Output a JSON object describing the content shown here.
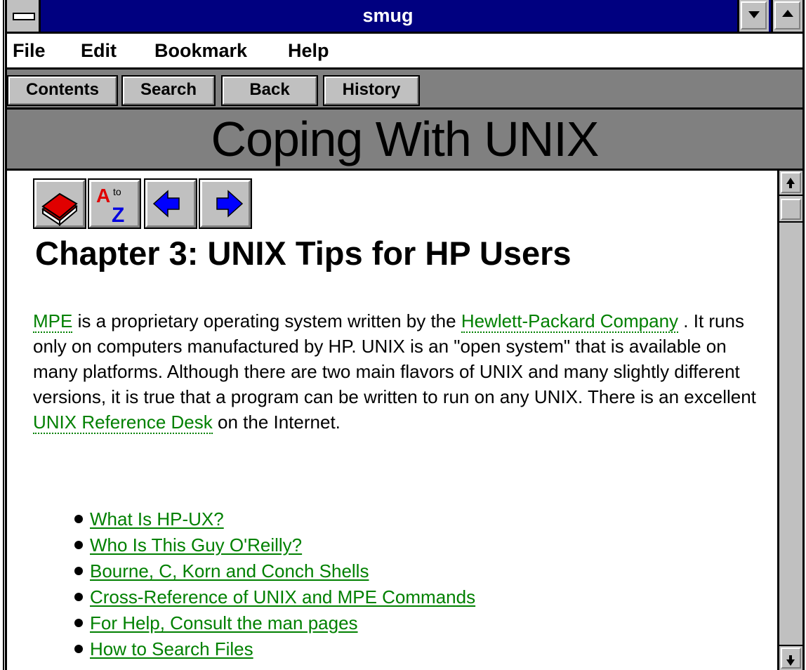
{
  "window": {
    "title": "smug"
  },
  "menu": {
    "items": [
      "File",
      "Edit",
      "Bookmark",
      "Help"
    ]
  },
  "toolbar": {
    "contents": "Contents",
    "search": "Search",
    "back": "Back",
    "history": "History"
  },
  "banner": {
    "title": "Coping With UNIX"
  },
  "nav_icons": [
    "book-icon",
    "a-to-z-index-icon",
    "previous-arrow-icon",
    "next-arrow-icon"
  ],
  "page": {
    "heading": "Chapter 3: UNIX Tips for HP Users",
    "para": {
      "link_mpe": "MPE",
      "t1": " is a proprietary operating system written by the ",
      "link_hp": "Hewlett-Packard Company",
      "t2": " . It runs only on computers manufactured by HP. UNIX is an \"open system\" that is available on many platforms. Although there are two main flavors of UNIX and many slightly different versions, it is true that a program can be written to run on any UNIX. There is an excellent ",
      "link_ref": "UNIX Reference Desk",
      "t3": "  on the Internet."
    },
    "links": [
      "What Is HP-UX?",
      "Who Is This Guy O'Reilly?",
      "Bourne, C, Korn and Conch Shells",
      "Cross-Reference of UNIX and MPE Commands",
      "For Help, Consult the man pages",
      "How to Search Files"
    ]
  },
  "colors": {
    "titlebar": "#000080",
    "link": "#008000",
    "chrome": "#c0c0c0",
    "band": "#808080"
  }
}
